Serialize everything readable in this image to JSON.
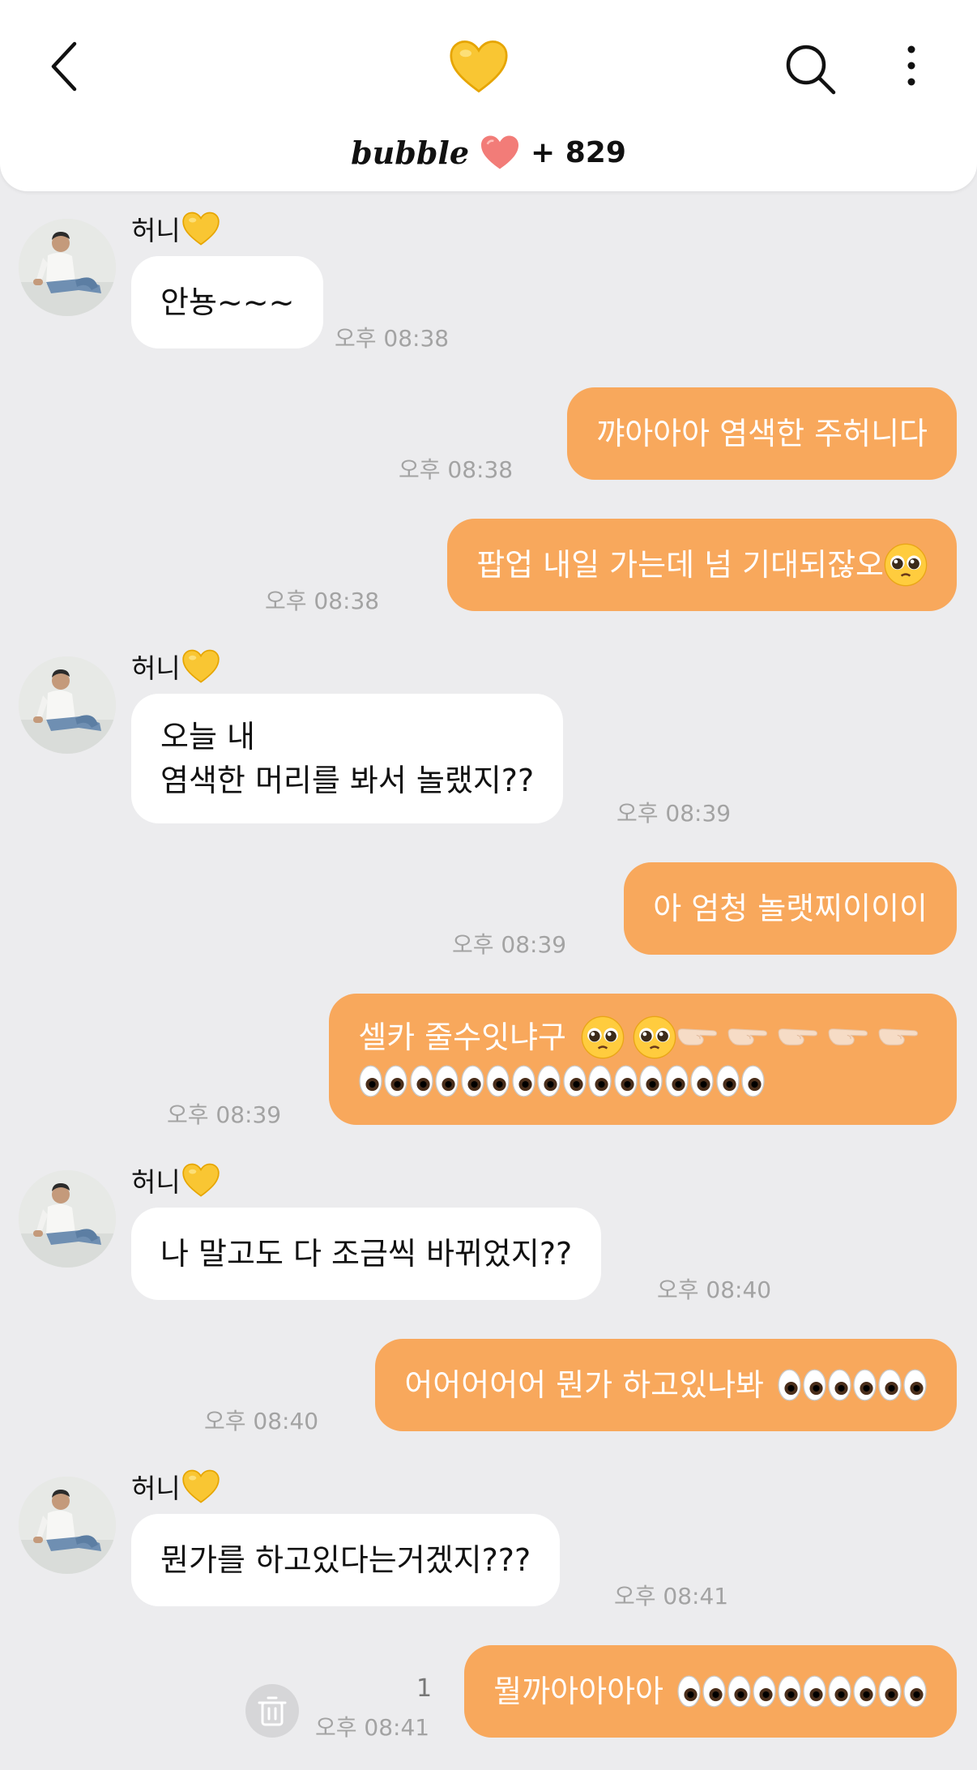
{
  "header": {
    "title_icon": "yellow-heart-icon",
    "logo": "bubble",
    "count": "+ 829",
    "colors": {
      "accent": "#f8a85c",
      "header_bg": "#ffffff",
      "chat_bg": "#ececee"
    }
  },
  "messages": [
    {
      "sender": "허니",
      "text": "안뇽~~~",
      "time": "오후 08:38"
    },
    {
      "text": "꺄아아아 염색한 주허니다",
      "time": "오후 08:38"
    },
    {
      "text": "팝업 내일 가는데 넘 기대되잖오",
      "time": "오후 08:38"
    },
    {
      "sender": "허니",
      "line1": "오늘 내",
      "line2": "염색한 머리를 봐서 놀랬지??",
      "time": "오후 08:39"
    },
    {
      "text": "아 엄청 놀랫찌이이이",
      "time": "오후 08:39"
    },
    {
      "text": "셀카 줄수잇냐구",
      "time": "오후 08:39"
    },
    {
      "sender": "허니",
      "text": "나 말고도 다 조금씩 바뀌었지??",
      "time": "오후 08:40"
    },
    {
      "text": "어어어어어 뭔가 하고있나봐",
      "time": "오후 08:40"
    },
    {
      "sender": "허니",
      "text": "뭔가를 하고있다는거겠지???",
      "time": "오후 08:41"
    },
    {
      "text": "뭘까아아아아",
      "time": "오후 08:41",
      "unread": "1"
    }
  ]
}
